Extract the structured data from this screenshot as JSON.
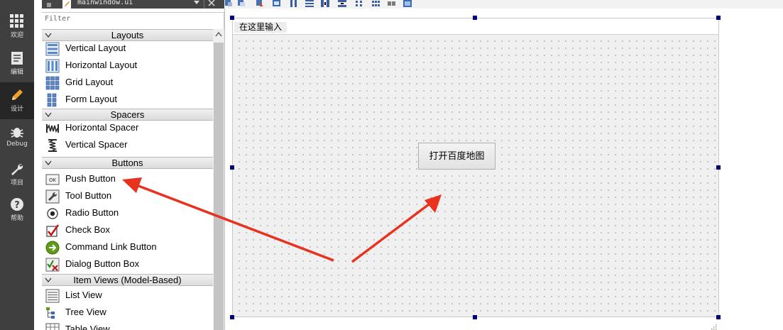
{
  "modebar": {
    "items": [
      {
        "label": "欢迎",
        "icon": "grid-icon"
      },
      {
        "label": "编辑",
        "icon": "document-icon"
      },
      {
        "label": "设计",
        "icon": "pencil-icon"
      },
      {
        "label": "Debug",
        "icon": "bug-icon"
      },
      {
        "label": "项目",
        "icon": "wrench-icon"
      },
      {
        "label": "帮助",
        "icon": "help-icon"
      }
    ],
    "active": "设计"
  },
  "document": {
    "file_name": "mainwindow.ui"
  },
  "widgetbox": {
    "filter_placeholder": "Filter",
    "categories": {
      "layouts": "Layouts",
      "spacers": "Spacers",
      "buttons": "Buttons",
      "item_views": "Item Views (Model-Based)"
    },
    "items": {
      "vertical_layout": "Vertical Layout",
      "horizontal_layout": "Horizontal Layout",
      "grid_layout": "Grid Layout",
      "form_layout": "Form Layout",
      "horizontal_spacer": "Horizontal Spacer",
      "vertical_spacer": "Vertical Spacer",
      "push_button": "Push Button",
      "tool_button": "Tool Button",
      "radio_button": "Radio Button",
      "check_box": "Check Box",
      "command_link_button": "Command Link Button",
      "dialog_button_box": "Dialog Button Box",
      "list_view": "List View",
      "tree_view": "Tree View",
      "table_view": "Table View"
    }
  },
  "form": {
    "menu_placeholder": "在这里输入",
    "push_button_label": "打开百度地图"
  },
  "colors": {
    "sidebar": "#3f3f3f",
    "sidebar_active": "#262626",
    "handle": "#00007a",
    "annotation_arrow": "#e8321f"
  }
}
